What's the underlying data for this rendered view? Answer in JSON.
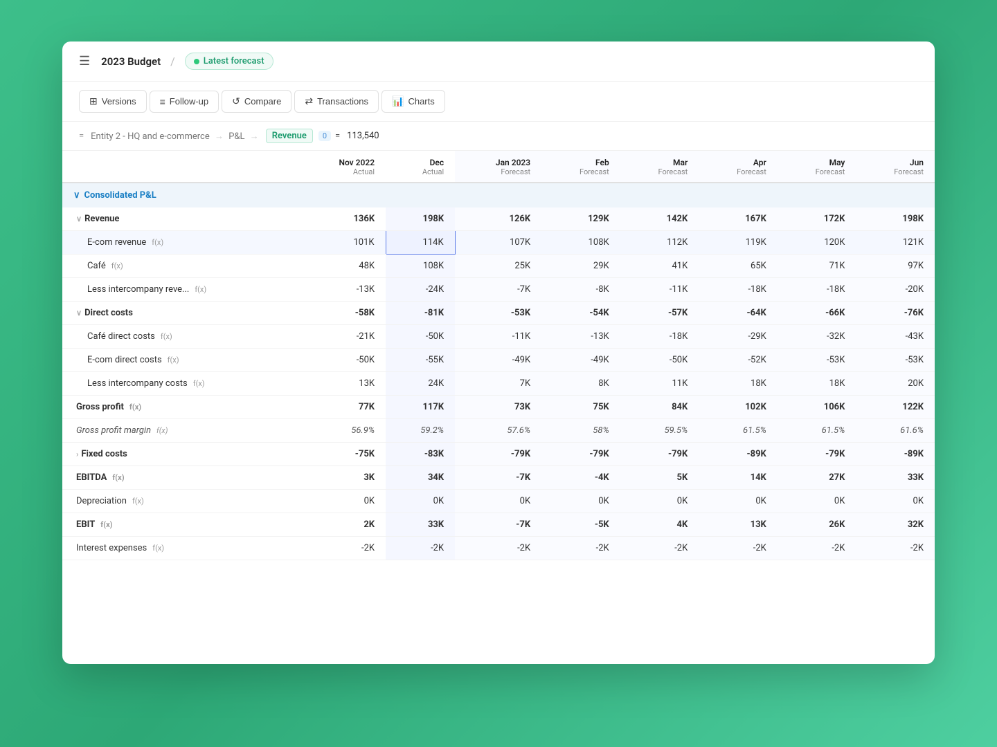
{
  "window": {
    "title": "2023 Budget",
    "breadcrumb_sep": "/",
    "forecast_label": "Latest forecast"
  },
  "toolbar": {
    "tabs": [
      {
        "id": "versions",
        "icon": "⊞",
        "label": "Versions"
      },
      {
        "id": "followup",
        "icon": "☰",
        "label": "Follow-up"
      },
      {
        "id": "compare",
        "icon": "↻",
        "label": "Compare"
      },
      {
        "id": "transactions",
        "icon": "⇄",
        "label": "Transactions"
      },
      {
        "id": "charts",
        "icon": "📊",
        "label": "Charts"
      }
    ]
  },
  "formula_bar": {
    "eq": "=",
    "entity": "Entity 2 - HQ and e-commerce",
    "sep1": "→",
    "pl": "P&L",
    "sep2": "→",
    "highlight": "Revenue",
    "badge": "0",
    "eq2": "=",
    "value": "113,540"
  },
  "columns": [
    {
      "month": "Nov 2022",
      "type": "Actual"
    },
    {
      "month": "Dec",
      "type": "Actual"
    },
    {
      "month": "Jan 2023",
      "type": "Forecast"
    },
    {
      "month": "Feb",
      "type": "Forecast"
    },
    {
      "month": "Mar",
      "type": "Forecast"
    },
    {
      "month": "Apr",
      "type": "Forecast"
    },
    {
      "month": "May",
      "type": "Forecast"
    },
    {
      "month": "Jun",
      "type": "Forecast"
    }
  ],
  "section_label": "Consolidated P&L",
  "rows": [
    {
      "id": "revenue",
      "label": "Revenue",
      "indent": 0,
      "toggle": true,
      "bold": true,
      "values": [
        "136K",
        "198K",
        "126K",
        "129K",
        "142K",
        "167K",
        "172K",
        "198K"
      ]
    },
    {
      "id": "ecom-rev",
      "label": "E-com revenue",
      "indent": 1,
      "fx": true,
      "selected": true,
      "values": [
        "101K",
        "114K",
        "107K",
        "108K",
        "112K",
        "119K",
        "120K",
        "121K"
      ]
    },
    {
      "id": "cafe",
      "label": "Café",
      "indent": 1,
      "fx": true,
      "values": [
        "48K",
        "108K",
        "25K",
        "29K",
        "41K",
        "65K",
        "71K",
        "97K"
      ]
    },
    {
      "id": "less-interco-rev",
      "label": "Less intercompany reve...",
      "indent": 1,
      "fx": true,
      "values": [
        "-13K",
        "-24K",
        "-7K",
        "-8K",
        "-11K",
        "-18K",
        "-18K",
        "-20K"
      ]
    },
    {
      "id": "direct-costs",
      "label": "Direct costs",
      "indent": 0,
      "toggle": true,
      "bold": true,
      "values": [
        "-58K",
        "-81K",
        "-53K",
        "-54K",
        "-57K",
        "-64K",
        "-66K",
        "-76K"
      ]
    },
    {
      "id": "cafe-direct",
      "label": "Café direct costs",
      "indent": 1,
      "fx": true,
      "values": [
        "-21K",
        "-50K",
        "-11K",
        "-13K",
        "-18K",
        "-29K",
        "-32K",
        "-43K"
      ]
    },
    {
      "id": "ecom-direct",
      "label": "E-com direct costs",
      "indent": 1,
      "fx": true,
      "values": [
        "-50K",
        "-55K",
        "-49K",
        "-49K",
        "-50K",
        "-52K",
        "-53K",
        "-53K"
      ]
    },
    {
      "id": "less-interco-costs",
      "label": "Less intercompany costs",
      "indent": 1,
      "fx": true,
      "values": [
        "13K",
        "24K",
        "7K",
        "8K",
        "11K",
        "18K",
        "18K",
        "20K"
      ]
    },
    {
      "id": "gross-profit",
      "label": "Gross profit",
      "indent": 0,
      "fx": true,
      "bold": true,
      "values": [
        "77K",
        "117K",
        "73K",
        "75K",
        "84K",
        "102K",
        "106K",
        "122K"
      ]
    },
    {
      "id": "gross-margin",
      "label": "Gross profit margin",
      "indent": 0,
      "fx": true,
      "italic": true,
      "values": [
        "56.9%",
        "59.2%",
        "57.6%",
        "58%",
        "59.5%",
        "61.5%",
        "61.5%",
        "61.6%"
      ]
    },
    {
      "id": "fixed-costs",
      "label": "Fixed costs",
      "indent": 0,
      "toggle": true,
      "toggle_collapsed": true,
      "bold": true,
      "values": [
        "-75K",
        "-83K",
        "-79K",
        "-79K",
        "-79K",
        "-89K",
        "-79K",
        "-89K"
      ]
    },
    {
      "id": "ebitda",
      "label": "EBITDA",
      "indent": 0,
      "fx": true,
      "bold": true,
      "values": [
        "3K",
        "34K",
        "-7K",
        "-4K",
        "5K",
        "14K",
        "27K",
        "33K"
      ]
    },
    {
      "id": "depreciation",
      "label": "Depreciation",
      "indent": 0,
      "fx": true,
      "values": [
        "0K",
        "0K",
        "0K",
        "0K",
        "0K",
        "0K",
        "0K",
        "0K"
      ]
    },
    {
      "id": "ebit",
      "label": "EBIT",
      "indent": 0,
      "fx": true,
      "bold": true,
      "values": [
        "2K",
        "33K",
        "-7K",
        "-5K",
        "4K",
        "13K",
        "26K",
        "32K"
      ]
    },
    {
      "id": "interest",
      "label": "Interest expenses",
      "indent": 0,
      "fx": true,
      "values": [
        "-2K",
        "-2K",
        "-2K",
        "-2K",
        "-2K",
        "-2K",
        "-2K",
        "-2K"
      ]
    }
  ]
}
